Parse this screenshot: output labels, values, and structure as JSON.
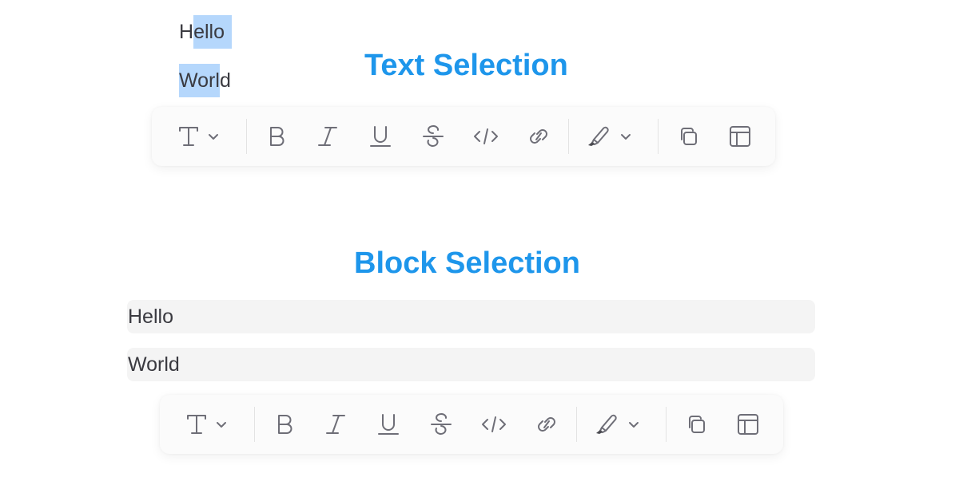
{
  "sections": {
    "text_selection": {
      "title": "Text Selection",
      "lines": [
        {
          "before": "H",
          "selected": "ello",
          "after": ""
        },
        {
          "before": "",
          "selected": "Worl",
          "after": "d"
        }
      ]
    },
    "block_selection": {
      "title": "Block Selection",
      "blocks": [
        "Hello",
        "World"
      ]
    }
  },
  "toolbar": {
    "items": [
      {
        "name": "text-style",
        "icon": "text-type-icon",
        "has_dropdown": true
      },
      {
        "name": "bold",
        "icon": "bold-icon"
      },
      {
        "name": "italic",
        "icon": "italic-icon"
      },
      {
        "name": "underline",
        "icon": "underline-icon"
      },
      {
        "name": "strikethrough",
        "icon": "strikethrough-icon"
      },
      {
        "name": "code",
        "icon": "code-icon"
      },
      {
        "name": "link",
        "icon": "link-icon"
      },
      {
        "name": "highlight",
        "icon": "highlighter-icon",
        "has_dropdown": true
      },
      {
        "name": "copy",
        "icon": "copy-icon"
      },
      {
        "name": "layout",
        "icon": "layout-icon"
      }
    ]
  },
  "colors": {
    "heading": "#1e96eb",
    "text_selection": "#b5d7fc",
    "block_selection": "#f4f4f4",
    "icon": "#6e6e77"
  }
}
